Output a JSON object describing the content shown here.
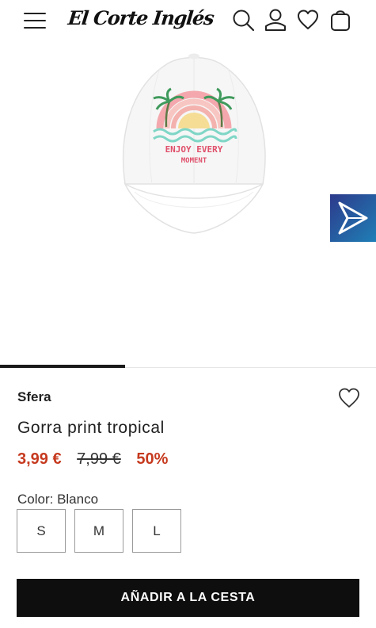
{
  "header": {
    "logo_text": "El Corte Inglés",
    "icons": [
      "menu-icon",
      "search-icon",
      "account-icon",
      "heart-icon",
      "bag-icon"
    ]
  },
  "gallery": {
    "image_subject": "white baseball cap with tropical sunset print",
    "print_text_line1": "ENJOY EVERY",
    "print_text_line2": "MOMENT",
    "progress_fraction": 0.333
  },
  "product": {
    "brand": "Sfera",
    "name": "Gorra print tropical",
    "price": "3,99 €",
    "old_price": "7,99 €",
    "discount": "50%",
    "color_label": "Color: Blanco",
    "sizes": [
      "S",
      "M",
      "L"
    ],
    "add_to_cart": "AÑADIR A LA CESTA"
  },
  "colors": {
    "accent_red": "#c63a1f",
    "button_black": "#0e0e0e",
    "badge_gradient_start": "#2d3a8c",
    "badge_gradient_end": "#1f7fb6"
  }
}
